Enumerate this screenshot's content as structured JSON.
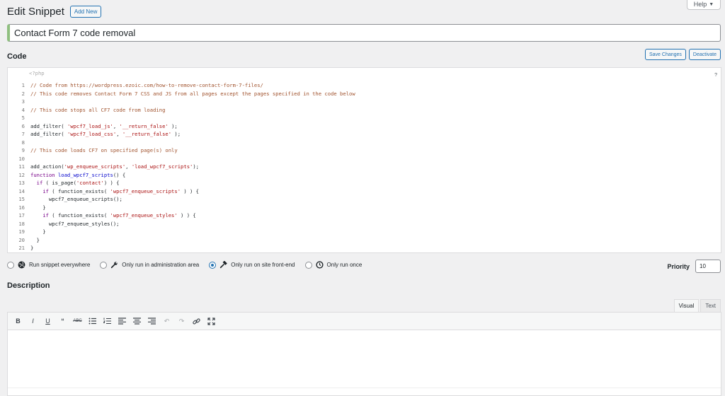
{
  "help": {
    "label": "Help"
  },
  "header": {
    "title": "Edit Snippet",
    "add_new": "Add New"
  },
  "snippet": {
    "name": "Contact Form 7 code removal"
  },
  "code": {
    "heading": "Code",
    "save_label": "Save Changes",
    "deactivate_label": "Deactivate",
    "php_open": "<?php",
    "help_mark": "?",
    "lines": [
      "// Code from https://wordpress.ezoic.com/how-to-remove-contact-form-7-files/",
      "// This code removes Contact Form 7 CSS and JS from all pages except the pages specified in the code below",
      "",
      "// This code stops all CF7 code from loading",
      "",
      "add_filter( 'wpcf7_load_js', '__return_false' );",
      "add_filter( 'wpcf7_load_css', '__return_false' );",
      "",
      "// This code loads CF7 on specified page(s) only",
      "",
      "add_action('wp_enqueue_scripts', 'load_wpcf7_scripts');",
      "function load_wpcf7_scripts() {",
      "  if ( is_page('contact') ) {",
      "    if ( function_exists( 'wpcf7_enqueue_scripts' ) ) {",
      "      wpcf7_enqueue_scripts();",
      "    }",
      "    if ( function_exists( 'wpcf7_enqueue_styles' ) ) {",
      "      wpcf7_enqueue_styles();",
      "    }",
      "  }",
      "}"
    ]
  },
  "scope": {
    "options": [
      {
        "label": "Run snippet everywhere",
        "icon": "globe-icon",
        "checked": false
      },
      {
        "label": "Only run in administration area",
        "icon": "wrench-icon",
        "checked": false
      },
      {
        "label": "Only run on site front-end",
        "icon": "hammer-icon",
        "checked": true
      },
      {
        "label": "Only run once",
        "icon": "clock-icon",
        "checked": false
      }
    ]
  },
  "priority": {
    "label": "Priority",
    "value": "10"
  },
  "description": {
    "heading": "Description",
    "tabs": [
      "Visual",
      "Text"
    ],
    "active_tab": "Visual"
  },
  "colors": {
    "accent": "#2271b1",
    "comment": "#a0522d",
    "string": "#aa1111",
    "keyword": "#770088"
  }
}
